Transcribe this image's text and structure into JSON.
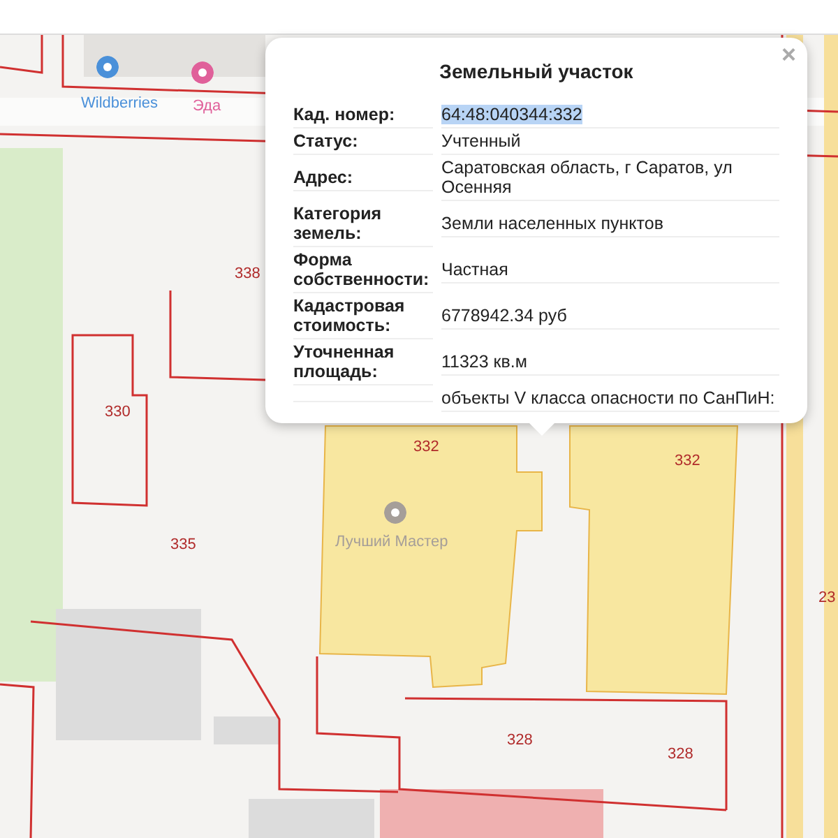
{
  "map": {
    "parcel_numbers": [
      "338",
      "330",
      "335",
      "332",
      "332",
      "328",
      "328",
      "23"
    ],
    "places": [
      {
        "name": "Wildberries",
        "color": "#4a90d9"
      },
      {
        "name": "Эда",
        "color": "#e0609a"
      },
      {
        "name": "Лучший Мастер",
        "color": "#a59e99"
      }
    ]
  },
  "popup": {
    "title": "Земельный участок",
    "close": "×",
    "rows": [
      {
        "label": "Кад. номер:",
        "value": "64:48:040344:332",
        "highlighted": true
      },
      {
        "label": "Статус:",
        "value": "Учтенный",
        "highlighted": false
      },
      {
        "label": "Адрес:",
        "value": "Саратовская область, г Саратов, ул Осенняя",
        "highlighted": false
      },
      {
        "label": "Категория земель:",
        "value": "Земли населенных пунктов",
        "highlighted": false
      },
      {
        "label": "Форма собственности:",
        "value": "Частная",
        "highlighted": false
      },
      {
        "label": "Кадастровая стоимость:",
        "value": "6778942.34 руб",
        "highlighted": false
      },
      {
        "label": "Уточненная площадь:",
        "value": "11323 кв.м",
        "highlighted": false
      },
      {
        "value": "объекты V класса опасности по СанПиН:",
        "highlighted": false
      }
    ]
  }
}
